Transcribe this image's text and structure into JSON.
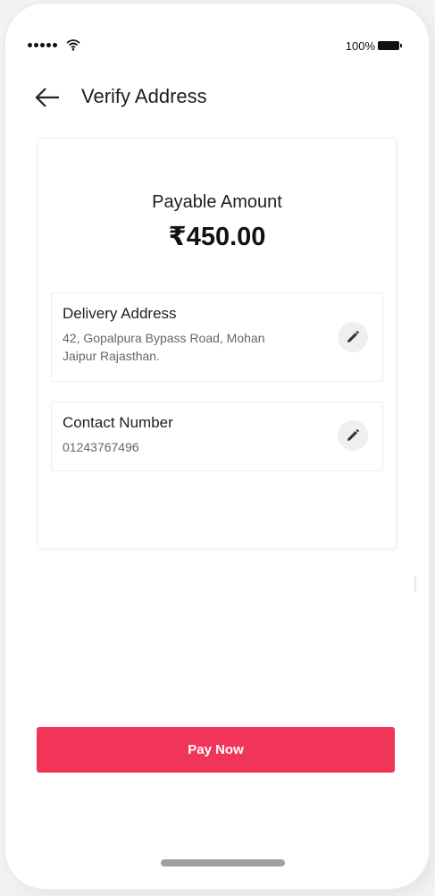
{
  "status_bar": {
    "battery_text": "100%"
  },
  "header": {
    "title": "Verify Address"
  },
  "payment": {
    "label": "Payable Amount",
    "amount": "₹450.00"
  },
  "delivery": {
    "label": "Delivery Address",
    "line1": "42, Gopalpura Bypass Road, Mohan",
    "line2": "Jaipur  Rajasthan."
  },
  "contact": {
    "label": "Contact Number",
    "value": "01243767496"
  },
  "actions": {
    "pay_label": "Pay Now"
  },
  "colors": {
    "accent": "#f03558"
  },
  "icons": [
    "back-arrow-icon",
    "signal-icon",
    "wifi-icon",
    "battery-icon",
    "edit-pencil-icon"
  ]
}
